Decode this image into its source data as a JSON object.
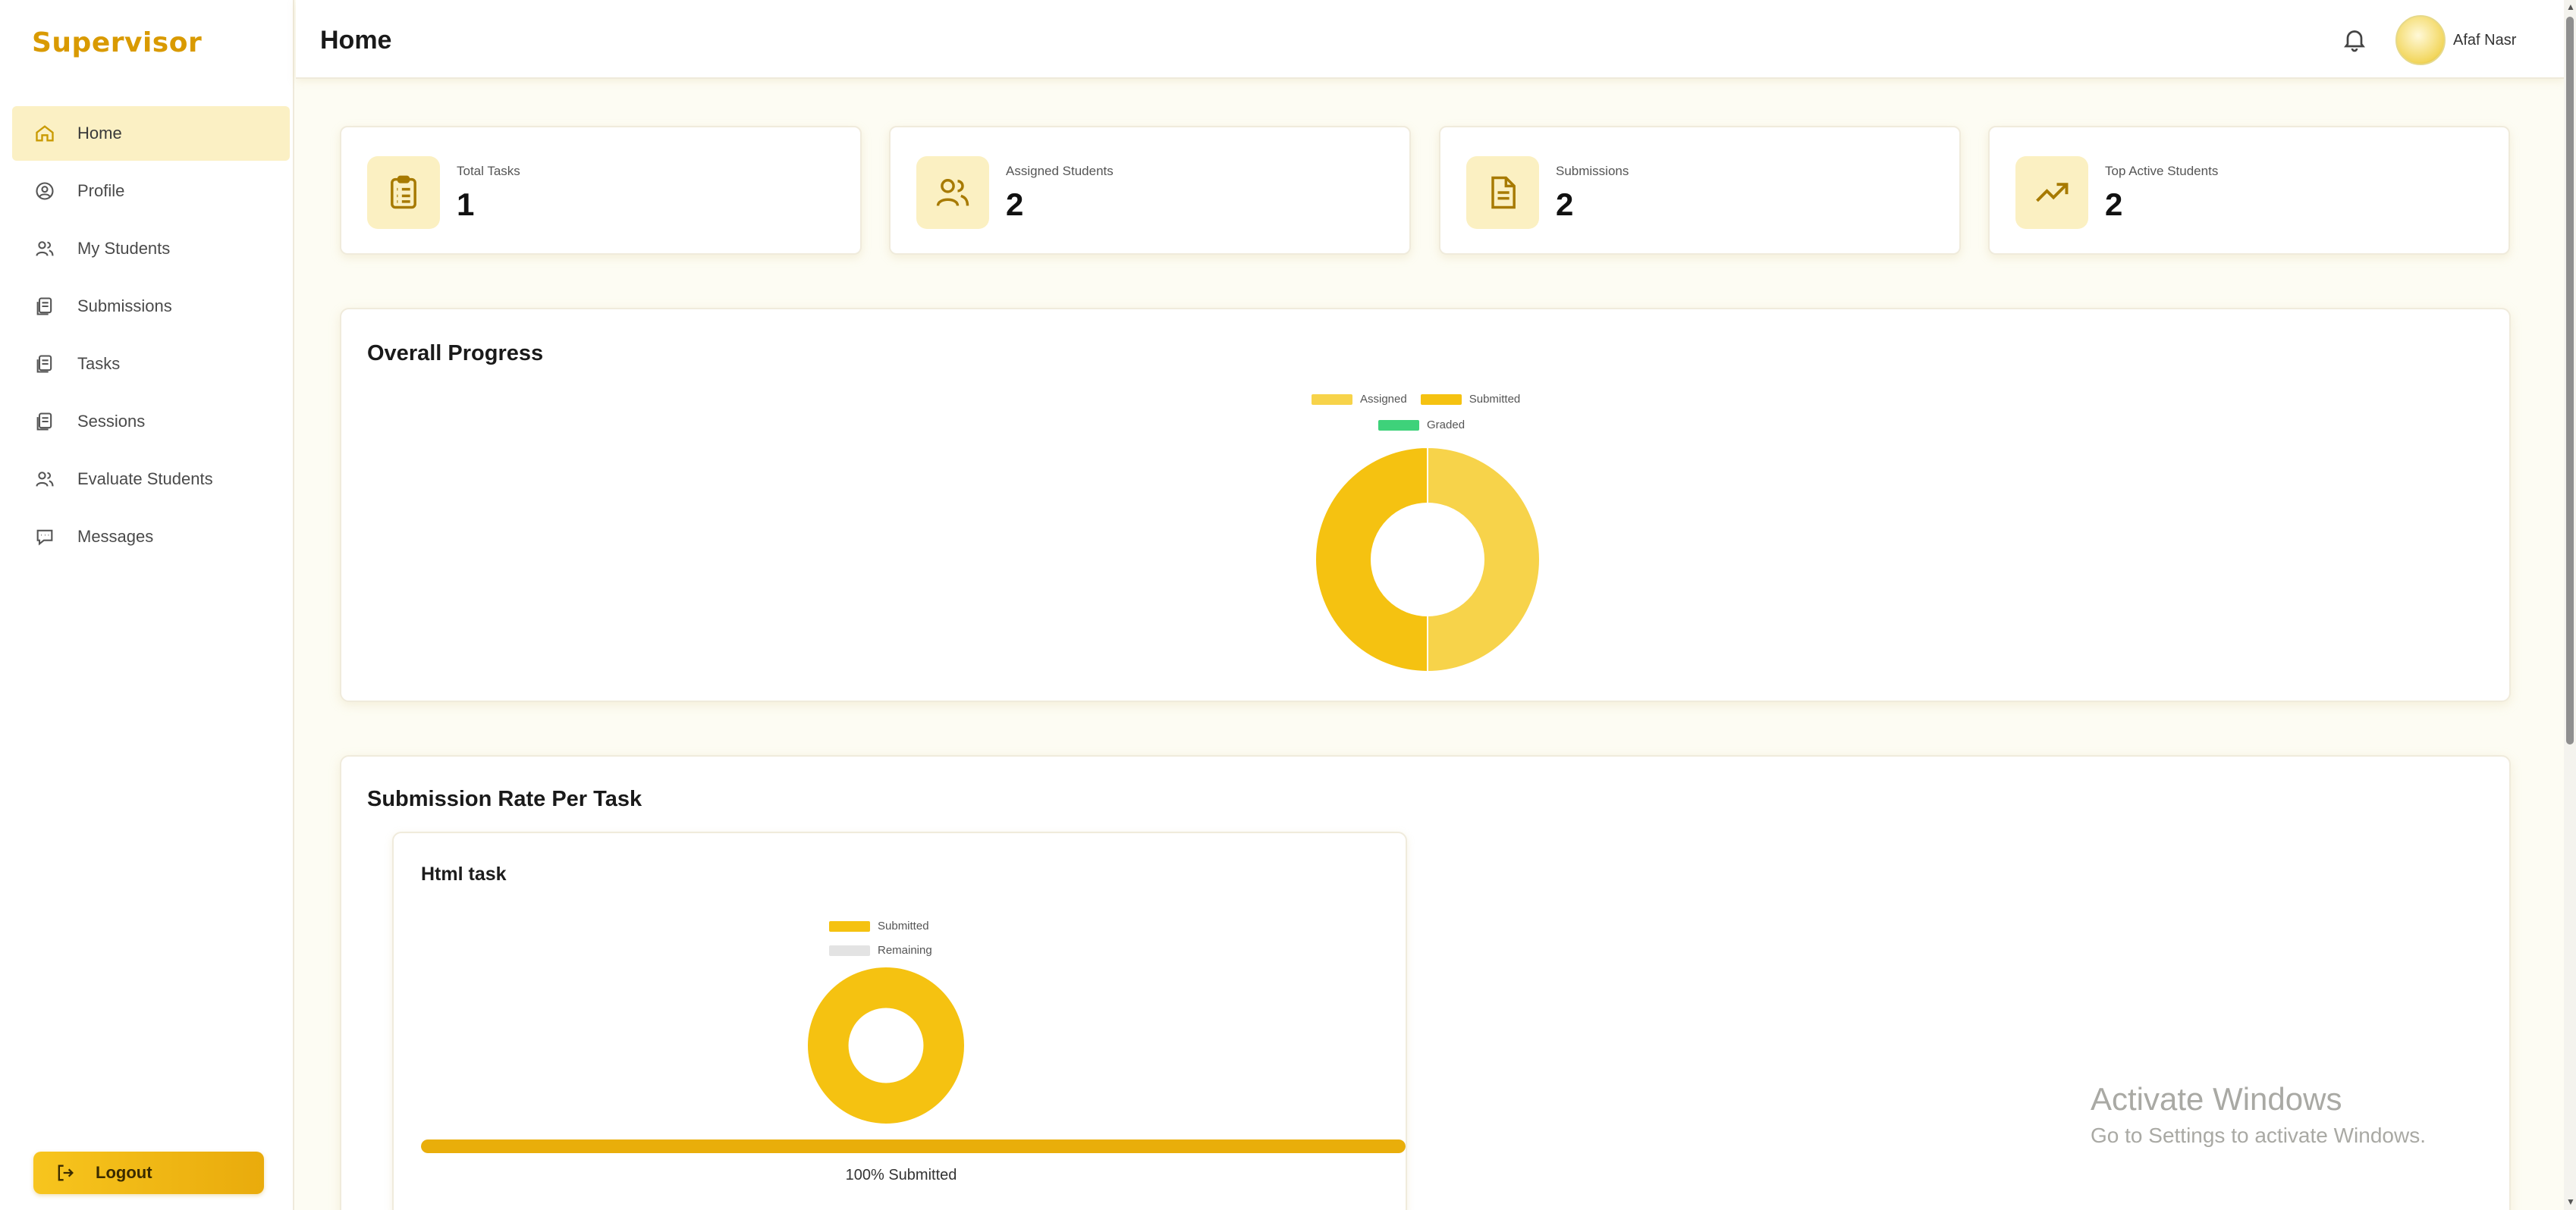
{
  "app": {
    "brand": "Supervisor"
  },
  "sidebar": {
    "items": [
      {
        "label": "Home",
        "icon": "home-icon",
        "active": true
      },
      {
        "label": "Profile",
        "icon": "profile-icon",
        "active": false
      },
      {
        "label": "My Students",
        "icon": "users-icon",
        "active": false
      },
      {
        "label": "Submissions",
        "icon": "files-icon",
        "active": false
      },
      {
        "label": "Tasks",
        "icon": "files-icon",
        "active": false
      },
      {
        "label": "Sessions",
        "icon": "files-icon",
        "active": false
      },
      {
        "label": "Evaluate Students",
        "icon": "users-icon",
        "active": false
      },
      {
        "label": "Messages",
        "icon": "messages-icon",
        "active": false
      }
    ],
    "logout_label": "Logout"
  },
  "header": {
    "title": "Home",
    "username": "Afaf Nasr"
  },
  "stats": [
    {
      "label": "Total Tasks",
      "value": "1",
      "icon": "clipboard-icon"
    },
    {
      "label": "Assigned Students",
      "value": "2",
      "icon": "users-icon"
    },
    {
      "label": "Submissions",
      "value": "2",
      "icon": "document-icon"
    },
    {
      "label": "Top Active Students",
      "value": "2",
      "icon": "trending-up-icon"
    }
  ],
  "overall_progress": {
    "title": "Overall Progress",
    "legend": [
      {
        "label": "Assigned",
        "color": "#f7d34a"
      },
      {
        "label": "Submitted",
        "color": "#f5c211"
      },
      {
        "label": "Graded",
        "color": "#3ed27a"
      }
    ]
  },
  "submission_rate": {
    "title": "Submission Rate Per Task",
    "task": {
      "title": "Html task",
      "legend": [
        {
          "label": "Submitted",
          "color": "#f5c211"
        },
        {
          "label": "Remaining",
          "color": "#e3e3e3"
        }
      ],
      "progress_percent": 100,
      "progress_label": "100% Submitted"
    }
  },
  "chart_data": [
    {
      "type": "pie",
      "title": "Overall Progress",
      "categories": [
        "Assigned",
        "Submitted",
        "Graded"
      ],
      "values": [
        2,
        2,
        0
      ],
      "colors": [
        "#f7d34a",
        "#f5c211",
        "#3ed27a"
      ],
      "legend": "top"
    },
    {
      "type": "pie",
      "title": "Html task",
      "categories": [
        "Submitted",
        "Remaining"
      ],
      "values": [
        2,
        0
      ],
      "colors": [
        "#f5c211",
        "#e3e3e3"
      ],
      "legend": "top"
    }
  ],
  "watermark": {
    "line1": "Activate Windows",
    "line2": "Go to Settings to activate Windows."
  }
}
